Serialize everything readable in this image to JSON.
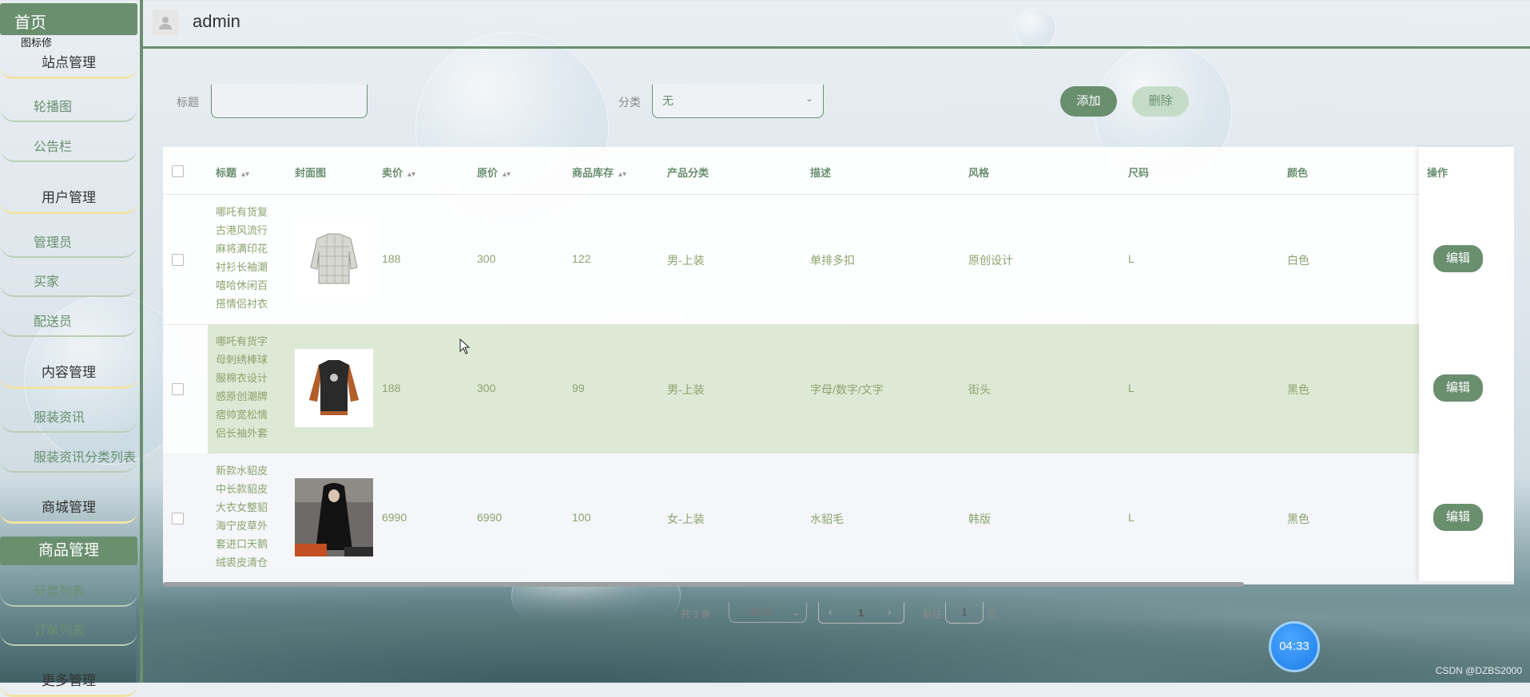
{
  "sidebar": {
    "home": "首页",
    "logo_text": "图标修",
    "groups": [
      "站点管理",
      "用户管理",
      "内容管理",
      "商城管理",
      "商品管理",
      "更多管理"
    ],
    "items": [
      "轮播图",
      "公告栏",
      "管理员",
      "买家",
      "配送员",
      "服装资讯",
      "服装资讯分类列表",
      "分类列表",
      "订单列表"
    ]
  },
  "header": {
    "username": "admin"
  },
  "filter": {
    "title_label": "标题",
    "title_value": "",
    "category_label": "分类",
    "category_value": "无",
    "add_label": "添加",
    "delete_label": "删除"
  },
  "table": {
    "headers": [
      "标题",
      "封面图",
      "卖价",
      "原价",
      "商品库存",
      "产品分类",
      "描述",
      "风格",
      "尺码",
      "颜色",
      "操作"
    ],
    "rows": [
      {
        "title": "哪吒有货复古港风流行麻将满印花衬衫长袖潮嘻哈休闲百搭情侣衬衣",
        "price": "188",
        "original": "300",
        "stock": "122",
        "category": "男-上装",
        "desc": "单排多扣",
        "style": "原创设计",
        "size": "L",
        "color": "白色",
        "edit": "编辑"
      },
      {
        "title": "哪吒有货字母刺绣棒球服棉衣设计感原创潮牌痞帅宽松情侣长袖外套",
        "price": "188",
        "original": "300",
        "stock": "99",
        "category": "男-上装",
        "desc": "字母/数字/文字",
        "style": "街头",
        "size": "L",
        "color": "黑色",
        "edit": "编辑"
      },
      {
        "title": "新款水貂皮中长款貂皮大衣女整貂海宁皮草外套进口天鹅绒裘皮清仓",
        "price": "6990",
        "original": "6990",
        "stock": "100",
        "category": "女-上装",
        "desc": "水貂毛",
        "style": "韩版",
        "size": "L",
        "color": "黑色",
        "edit": "编辑"
      }
    ]
  },
  "pagination": {
    "total": "共 3 条",
    "page_size": "7条/页",
    "current": "1",
    "goto_label": "前往",
    "goto_value": "1",
    "page_unit": "页"
  },
  "timer": "04:33",
  "watermark": "CSDN @DZBS2000"
}
